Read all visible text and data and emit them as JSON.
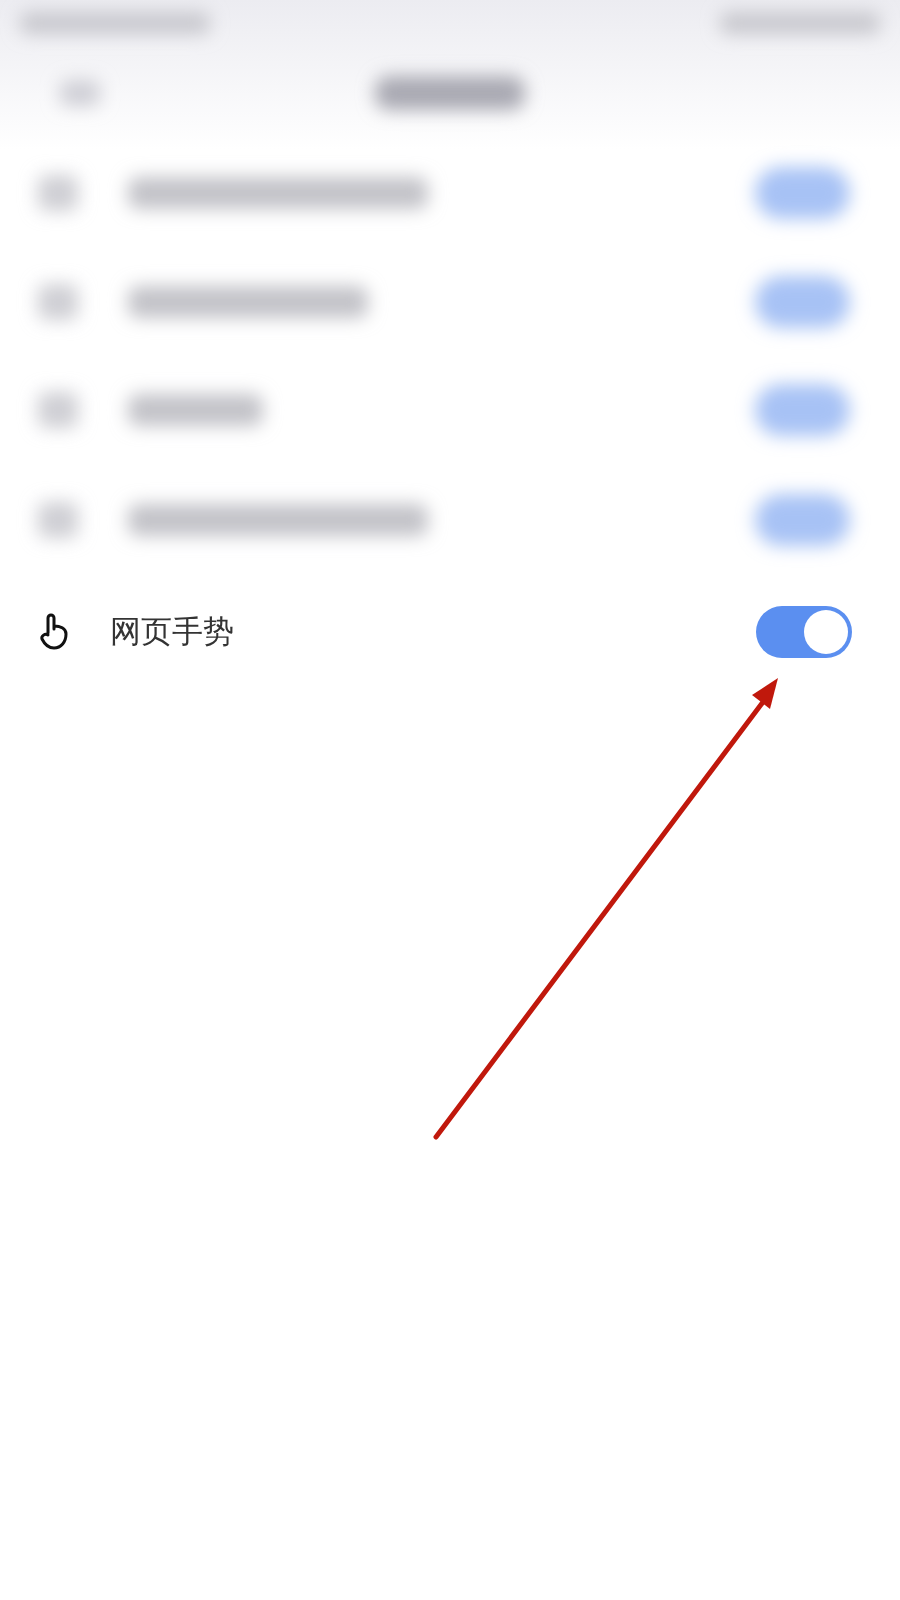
{
  "setting": {
    "label": "网页手势",
    "on": true
  }
}
